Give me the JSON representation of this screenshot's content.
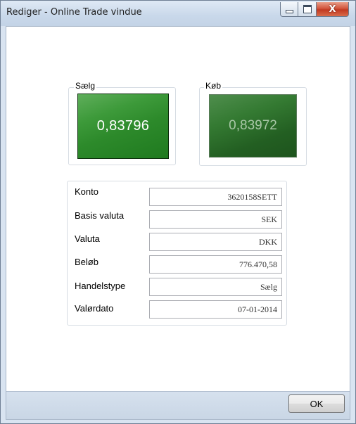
{
  "window": {
    "title": "Rediger - Online Trade vindue",
    "ghost_title": "",
    "controls": {
      "minimize_icon": "minimize-icon",
      "maximize_icon": "maximize-icon",
      "close_icon": "close-icon",
      "close_glyph": "X"
    }
  },
  "prices": {
    "sell_label": "Sælg",
    "sell_value": "0,83796",
    "buy_label": "Køb",
    "buy_value": "0,83972",
    "sell_color": "#2f8f2d",
    "buy_color": "#2b6e2a"
  },
  "details": {
    "rows": [
      {
        "label": "Konto",
        "value": "3620158SETT"
      },
      {
        "label": "Basis valuta",
        "value": "SEK"
      },
      {
        "label": "Valuta",
        "value": "DKK"
      },
      {
        "label": "Beløb",
        "value": "776.470,58"
      },
      {
        "label": "Handelstype",
        "value": "Sælg"
      },
      {
        "label": "Valørdato",
        "value": "07-01-2014"
      }
    ]
  },
  "footer": {
    "ok_label": "OK"
  }
}
